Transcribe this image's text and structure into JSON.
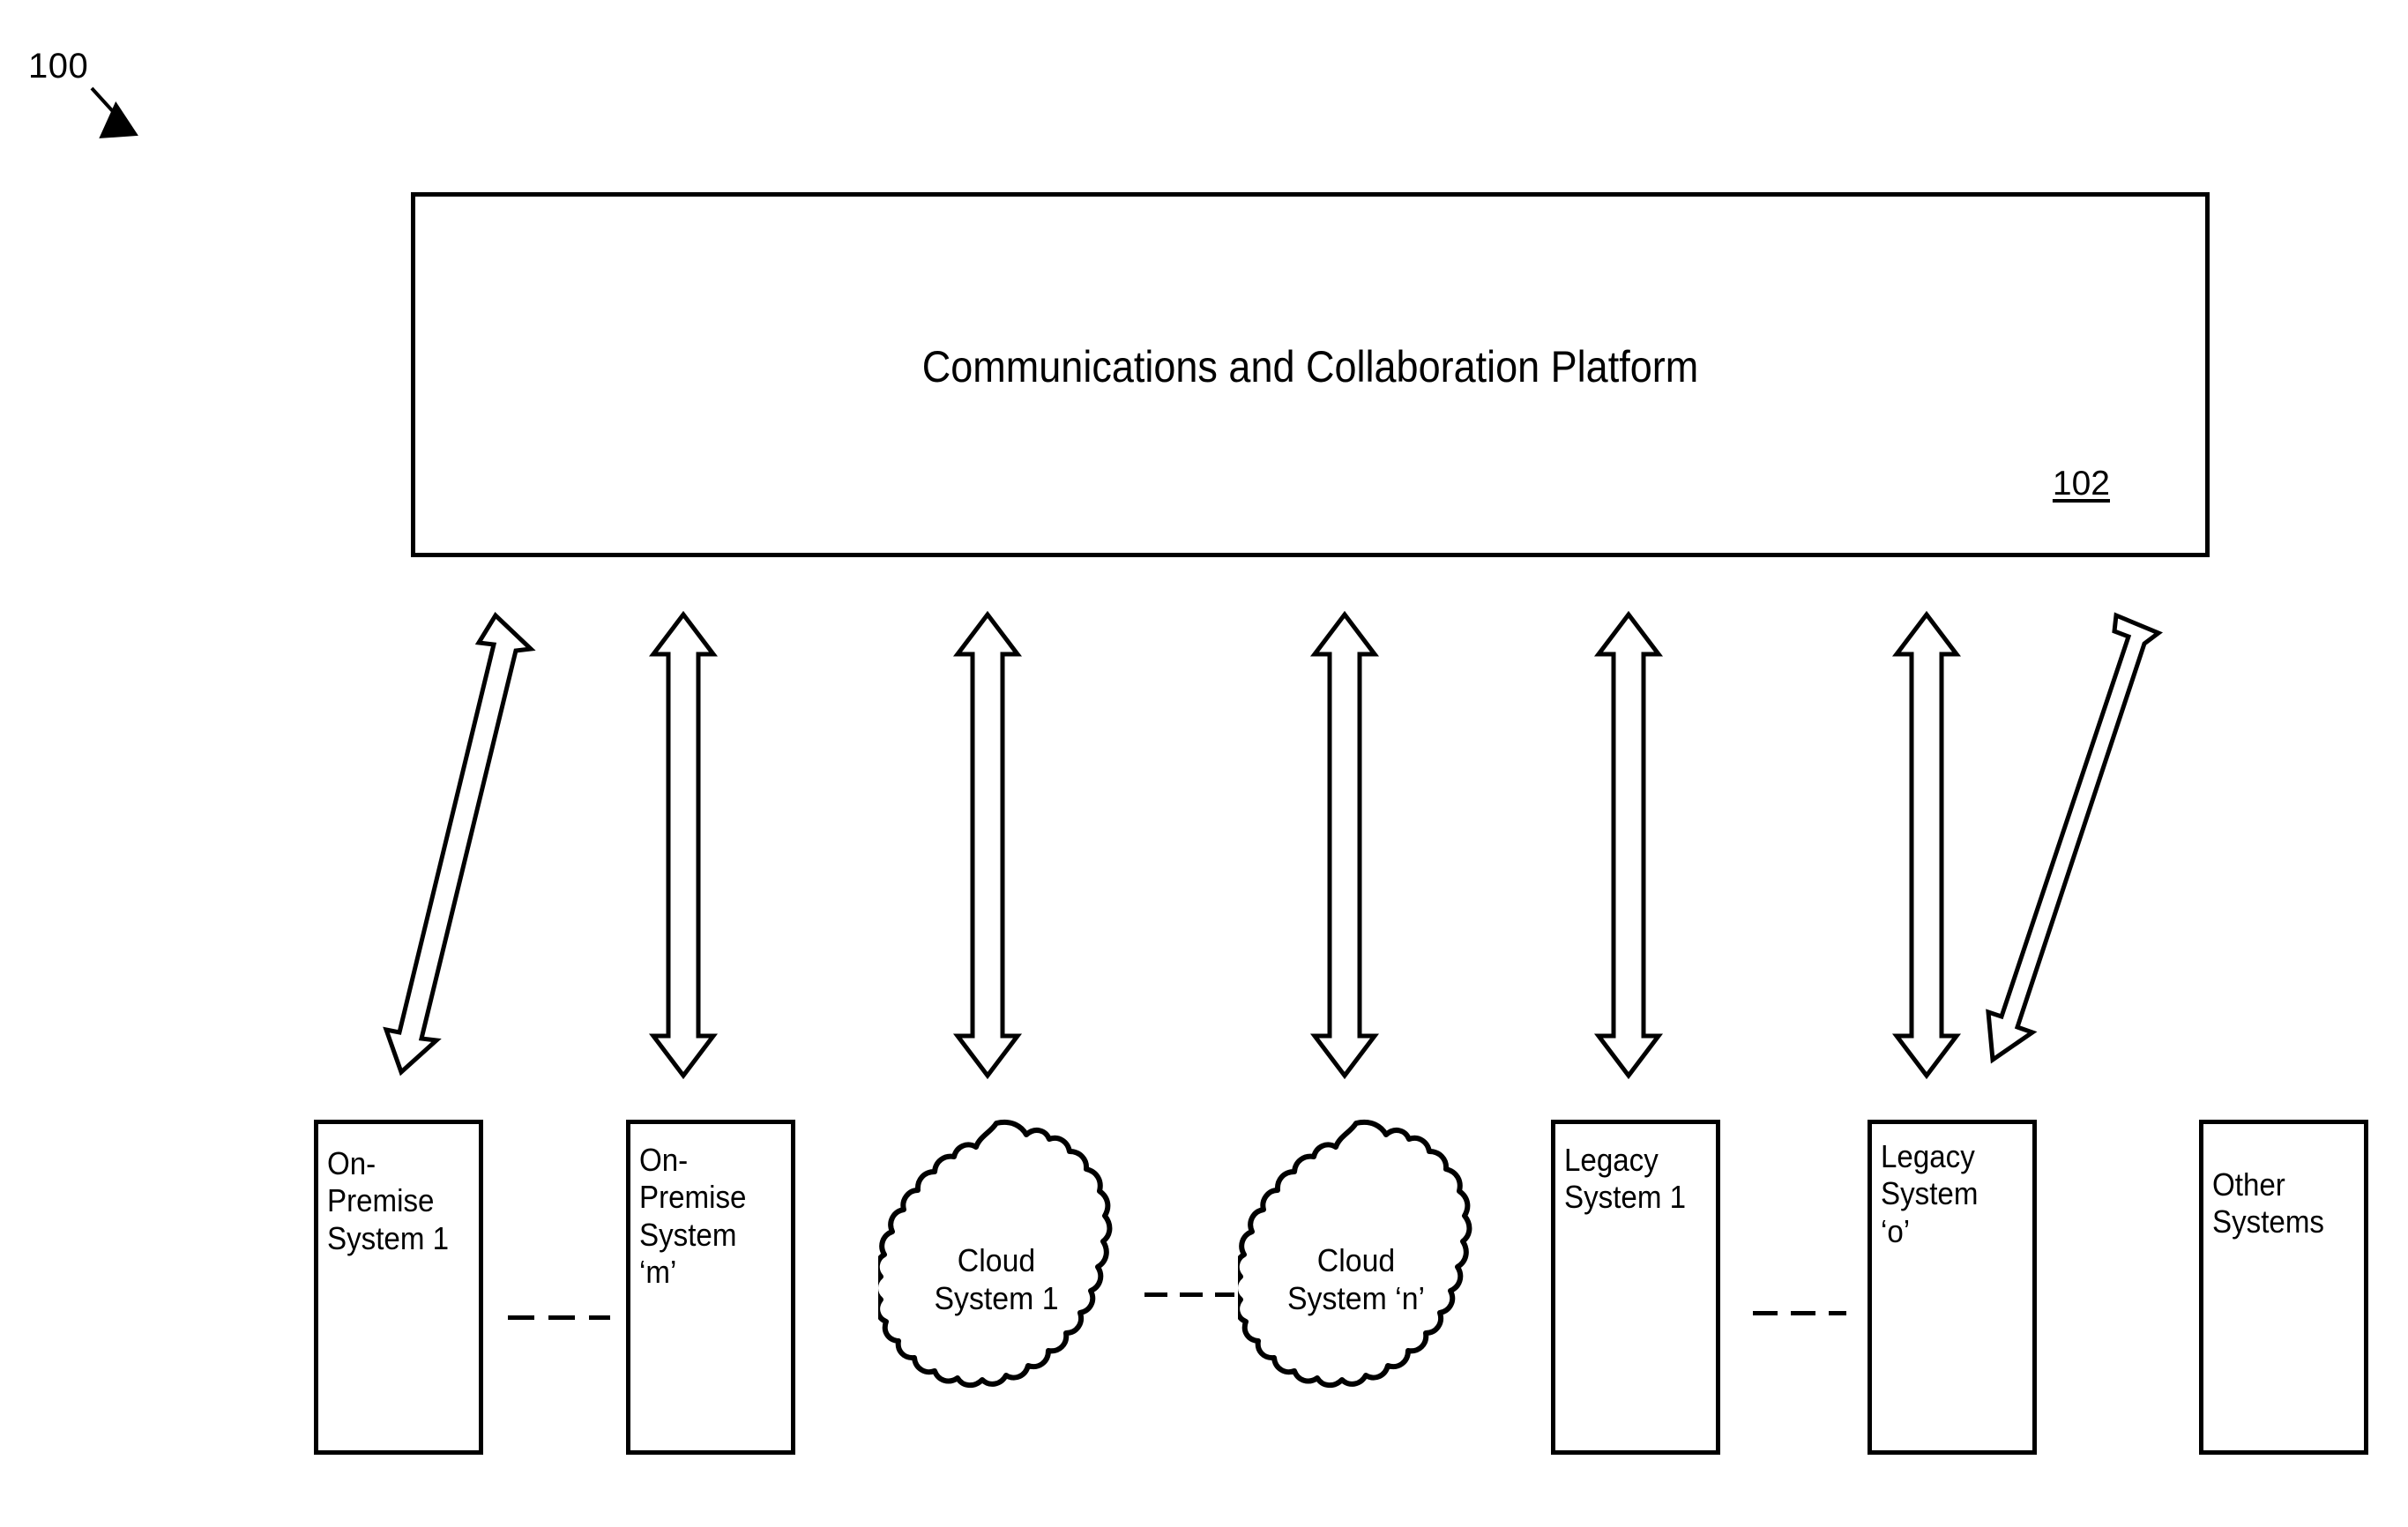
{
  "figure": {
    "number": "100",
    "pointer_icon": "diagonal-arrow-icon"
  },
  "platform": {
    "title": "Communications and Collaboration Platform",
    "reference_numeral": "102"
  },
  "nodes": [
    {
      "id": "on-premise-system-1",
      "type": "box",
      "label": "On-\nPremise\nSystem 1"
    },
    {
      "id": "on-premise-system-m",
      "type": "box",
      "label": "On-\nPremise\nSystem\n‘m’"
    },
    {
      "id": "cloud-system-1",
      "type": "cloud",
      "label": "Cloud\nSystem 1"
    },
    {
      "id": "cloud-system-n",
      "type": "cloud",
      "label": "Cloud\nSystem ‘n’"
    },
    {
      "id": "legacy-system-1",
      "type": "box",
      "label": "Legacy\nSystem 1"
    },
    {
      "id": "legacy-system-o",
      "type": "box",
      "label": "Legacy\nSystem\n‘o’"
    },
    {
      "id": "other-systems",
      "type": "box",
      "label": "Other\nSystems"
    }
  ],
  "connectors": {
    "count": 7,
    "style": "hollow-double-headed-arrow",
    "description": "bidirectional arrows between platform and each system"
  },
  "ellipses": [
    {
      "id": "ellipsis-on-premise",
      "symbol": "— — —"
    },
    {
      "id": "ellipsis-cloud",
      "symbol": "— — —"
    },
    {
      "id": "ellipsis-legacy",
      "symbol": "— — —"
    }
  ],
  "colors": {
    "stroke": "#000000",
    "fill": "#ffffff",
    "background": "#ffffff"
  }
}
